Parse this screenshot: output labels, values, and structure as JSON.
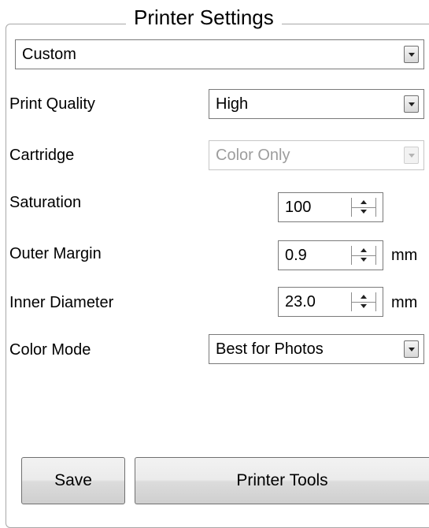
{
  "group": {
    "title": "Printer Settings"
  },
  "preset": {
    "value": "Custom"
  },
  "fields": {
    "print_quality": {
      "label": "Print Quality",
      "value": "High"
    },
    "cartridge": {
      "label": "Cartridge",
      "value": "Color Only"
    },
    "saturation": {
      "label": "Saturation",
      "value": "100"
    },
    "outer_margin": {
      "label": "Outer Margin",
      "value": "0.9",
      "unit": "mm"
    },
    "inner_diameter": {
      "label": "Inner Diameter",
      "value": "23.0",
      "unit": "mm"
    },
    "color_mode": {
      "label": "Color Mode",
      "value": "Best for Photos"
    }
  },
  "buttons": {
    "save": "Save",
    "printer_tools": "Printer Tools"
  }
}
